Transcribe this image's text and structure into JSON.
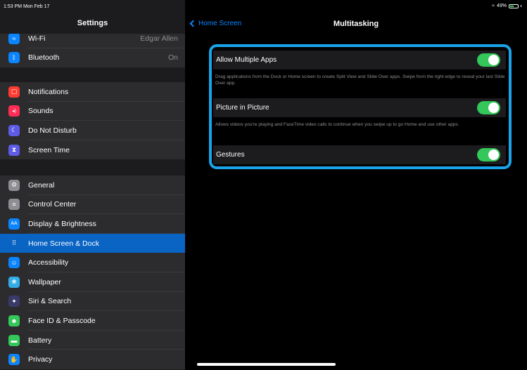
{
  "status": {
    "time": "1:53 PM  Mon Feb 17",
    "battery": "49%"
  },
  "sidebar": {
    "title": "Settings",
    "groups": [
      {
        "items": [
          {
            "name": "wifi",
            "label": "Wi-Fi",
            "value": "Edgar Allen",
            "icon": "wifi-icon",
            "color": "#0a84ff",
            "glyph": "≈"
          },
          {
            "name": "bluetooth",
            "label": "Bluetooth",
            "value": "On",
            "icon": "bluetooth-icon",
            "color": "#0a84ff",
            "glyph": "ᛒ"
          }
        ]
      },
      {
        "items": [
          {
            "name": "notifications",
            "label": "Notifications",
            "icon": "notifications-icon",
            "color": "#ff3b30",
            "glyph": "▢"
          },
          {
            "name": "sounds",
            "label": "Sounds",
            "icon": "sounds-icon",
            "color": "#ff2d55",
            "glyph": "◂)"
          },
          {
            "name": "do-not-disturb",
            "label": "Do Not Disturb",
            "icon": "moon-icon",
            "color": "#5e5ce6",
            "glyph": "☾"
          },
          {
            "name": "screen-time",
            "label": "Screen Time",
            "icon": "hourglass-icon",
            "color": "#5e5ce6",
            "glyph": "⧗"
          }
        ]
      },
      {
        "items": [
          {
            "name": "general",
            "label": "General",
            "icon": "gear-icon",
            "color": "#8e8e93",
            "glyph": "⚙"
          },
          {
            "name": "control-center",
            "label": "Control Center",
            "icon": "switches-icon",
            "color": "#8e8e93",
            "glyph": "≡"
          },
          {
            "name": "display",
            "label": "Display & Brightness",
            "icon": "display-icon",
            "color": "#0a84ff",
            "glyph": "AA"
          },
          {
            "name": "home-screen",
            "label": "Home Screen & Dock",
            "icon": "grid-icon",
            "color": "#0a64c4",
            "glyph": "⠿",
            "selected": true
          },
          {
            "name": "accessibility",
            "label": "Accessibility",
            "icon": "accessibility-icon",
            "color": "#0a84ff",
            "glyph": "☺"
          },
          {
            "name": "wallpaper",
            "label": "Wallpaper",
            "icon": "wallpaper-icon",
            "color": "#32ade6",
            "glyph": "❀"
          },
          {
            "name": "siri",
            "label": "Siri & Search",
            "icon": "siri-icon",
            "color": "#3a3a6a",
            "glyph": "✦"
          },
          {
            "name": "face-id",
            "label": "Face ID & Passcode",
            "icon": "face-id-icon",
            "color": "#34c759",
            "glyph": "☻"
          },
          {
            "name": "battery",
            "label": "Battery",
            "icon": "battery-icon",
            "color": "#34c759",
            "glyph": "▬"
          },
          {
            "name": "privacy",
            "label": "Privacy",
            "icon": "hand-icon",
            "color": "#0a84ff",
            "glyph": "✋"
          }
        ]
      }
    ]
  },
  "detail": {
    "back_label": "Home Screen",
    "title": "Multitasking",
    "options": [
      {
        "label": "Allow Multiple Apps",
        "on": true,
        "desc": "Drag applications from the Dock or Home screen to create Split View and Slide Over apps. Swipe from the right edge to reveal your last Slide Over app."
      },
      {
        "label": "Picture in Picture",
        "on": true,
        "desc": "Allows videos you're playing and FaceTime video calls to continue when you swipe up to go Home and use other apps."
      },
      {
        "label": "Gestures",
        "on": true,
        "desc": ""
      }
    ]
  },
  "colors": {
    "accent": "#0a84ff",
    "toggle_on": "#34c759",
    "highlight": "#1aa3e8",
    "selected_row": "#0a64c4"
  }
}
